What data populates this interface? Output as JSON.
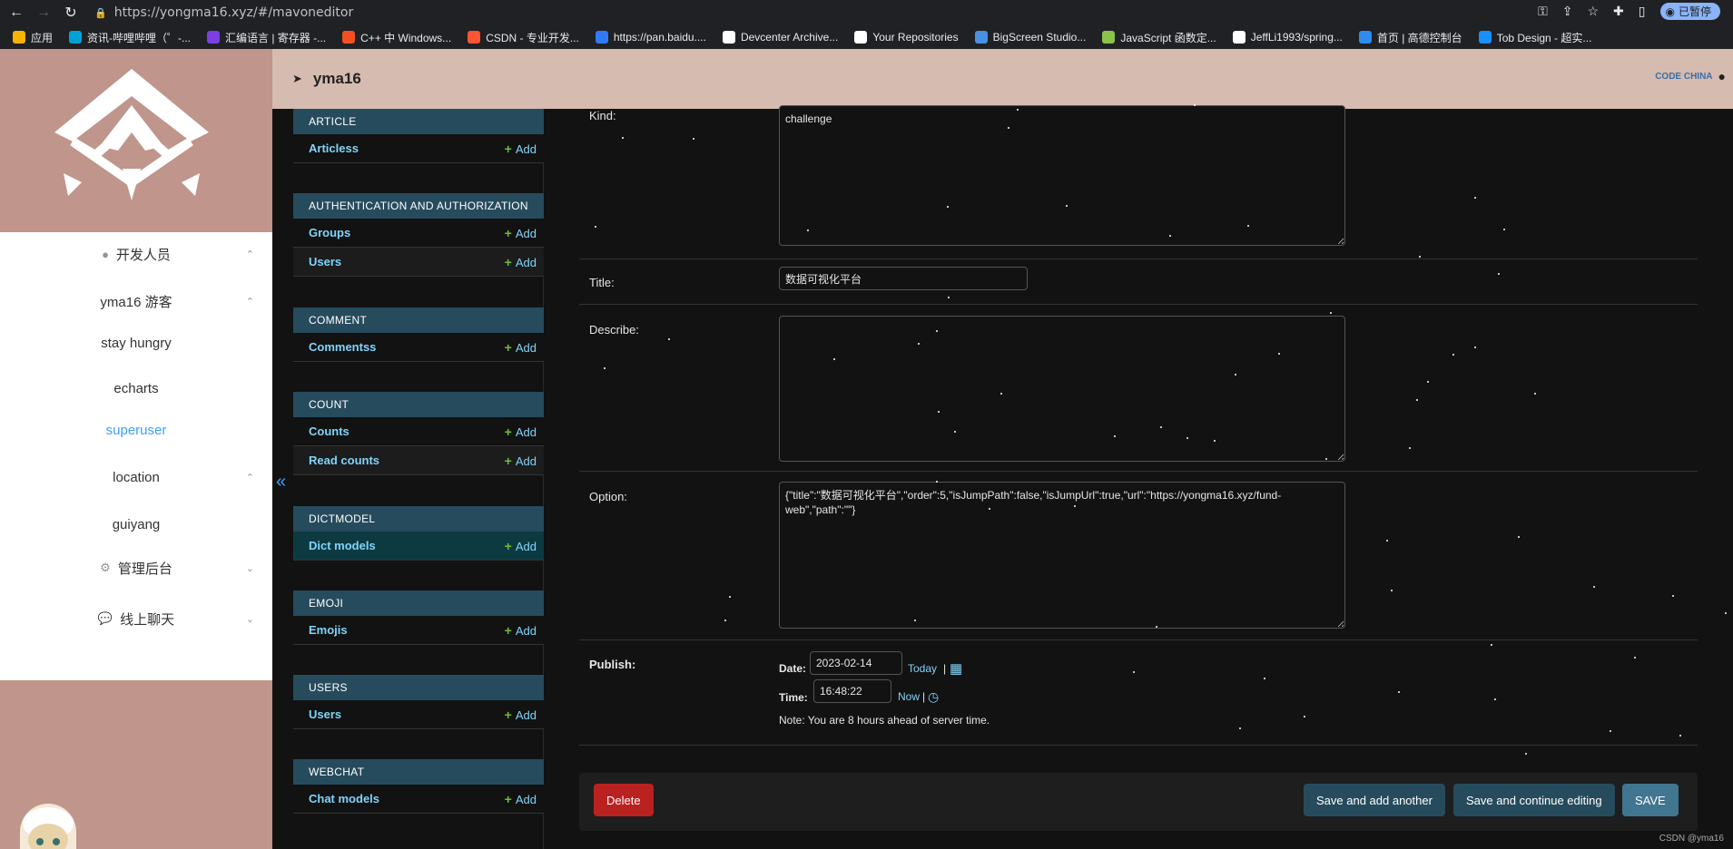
{
  "browser": {
    "url": "https://yongma16.xyz/#/mavoneditor",
    "paused_label": "已暂停",
    "bookmarks": [
      {
        "label": "应用",
        "color": "#f4b400"
      },
      {
        "label": "资讯-哔哩哔哩（゜-...",
        "color": "#00a1d6"
      },
      {
        "label": "汇编语言 | 寄存器 -...",
        "color": "#7b3fe4"
      },
      {
        "label": "C++ 中 Windows...",
        "color": "#f25022"
      },
      {
        "label": "CSDN - 专业开发...",
        "color": "#fc5531"
      },
      {
        "label": "https://pan.baidu....",
        "color": "#2f7bf5"
      },
      {
        "label": "Devcenter Archive...",
        "color": "#ffffff"
      },
      {
        "label": "Your Repositories",
        "color": "#ffffff"
      },
      {
        "label": "BigScreen Studio...",
        "color": "#4a90e2"
      },
      {
        "label": "JavaScript 函数定...",
        "color": "#8bc34a"
      },
      {
        "label": "JeffLi1993/spring...",
        "color": "#ffffff"
      },
      {
        "label": "首页 | 高德控制台",
        "color": "#2d8cf0"
      },
      {
        "label": "Tob Design - 超实...",
        "color": "#1890ff"
      }
    ]
  },
  "sidebar": {
    "items": [
      {
        "label": "开发人员",
        "icon": "user-icon",
        "chevron": "up"
      },
      {
        "label": "yma16 游客",
        "icon": "",
        "chevron": "up"
      },
      {
        "label": "stay hungry",
        "icon": "",
        "chevron": ""
      },
      {
        "label": "echarts",
        "icon": "",
        "chevron": ""
      },
      {
        "label": "superuser",
        "icon": "",
        "chevron": "",
        "active": true
      },
      {
        "label": "location",
        "icon": "",
        "chevron": "up"
      },
      {
        "label": "guiyang",
        "icon": "",
        "chevron": ""
      },
      {
        "label": "管理后台",
        "icon": "gear-icon",
        "chevron": "down"
      },
      {
        "label": "线上聊天",
        "icon": "chat-icon",
        "chevron": "down"
      }
    ],
    "collapse_glyph": "«"
  },
  "header": {
    "username": "yma16",
    "brand_text": "CODE CHINA"
  },
  "admin_apps": [
    {
      "caption": "ARTICLE",
      "models": [
        {
          "name": "Articless",
          "add": "Add"
        }
      ]
    },
    {
      "caption": "AUTHENTICATION AND AUTHORIZATION",
      "models": [
        {
          "name": "Groups",
          "add": "Add"
        },
        {
          "name": "Users",
          "add": "Add"
        }
      ]
    },
    {
      "caption": "COMMENT",
      "models": [
        {
          "name": "Commentss",
          "add": "Add"
        }
      ]
    },
    {
      "caption": "COUNT",
      "models": [
        {
          "name": "Counts",
          "add": "Add"
        },
        {
          "name": "Read counts",
          "add": "Add"
        }
      ]
    },
    {
      "caption": "DICTMODEL",
      "models": [
        {
          "name": "Dict models",
          "add": "Add"
        }
      ]
    },
    {
      "caption": "EMOJI",
      "models": [
        {
          "name": "Emojis",
          "add": "Add"
        }
      ]
    },
    {
      "caption": "USERS",
      "models": [
        {
          "name": "Users",
          "add": "Add"
        }
      ]
    },
    {
      "caption": "WEBCHAT",
      "models": [
        {
          "name": "Chat models",
          "add": "Add"
        }
      ]
    }
  ],
  "form": {
    "kind_label": "Kind:",
    "kind_value": "challenge",
    "title_label": "Title:",
    "title_value": "数据可视化平台",
    "describe_label": "Describe:",
    "describe_value": "",
    "option_label": "Option:",
    "option_value": "{\"title\":\"数据可视化平台\",\"order\":5,\"isJumpPath\":false,\"isJumpUrl\":true,\"url\":\"https://yongma16.xyz/fund-web\",\"path\":\"\"}",
    "publish_label": "Publish:",
    "date_label": "Date:",
    "date_value": "2023-02-14",
    "today_link": "Today",
    "time_label": "Time:",
    "time_value": "16:48:22",
    "now_link": "Now",
    "sep": "|",
    "note": "Note: You are 8 hours ahead of server time."
  },
  "actions": {
    "delete": "Delete",
    "save_add_another": "Save and add another",
    "save_continue": "Save and continue editing",
    "save": "SAVE"
  },
  "watermark": "CSDN @yma16"
}
